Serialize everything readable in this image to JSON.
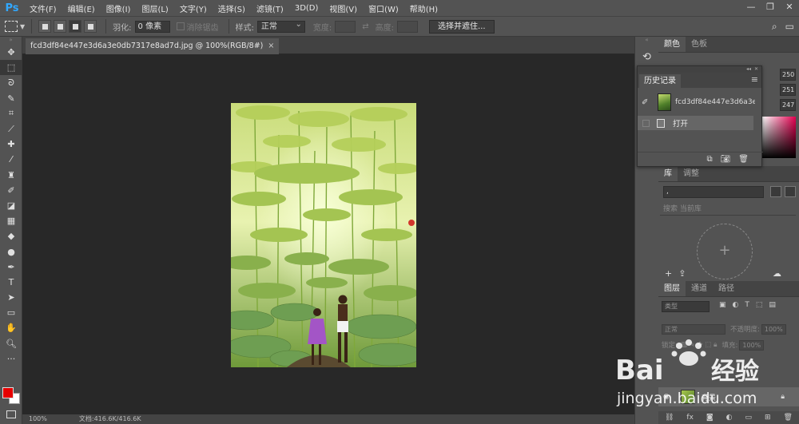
{
  "app": {
    "logo": "Ps"
  },
  "menu": [
    "文件(F)",
    "编辑(E)",
    "图像(I)",
    "图层(L)",
    "文字(Y)",
    "选择(S)",
    "滤镜(T)",
    "3D(D)",
    "视图(V)",
    "窗口(W)",
    "帮助(H)"
  ],
  "window_controls": {
    "minimize": "—",
    "restore": "❐",
    "close": "✕"
  },
  "options": {
    "feather_label": "羽化:",
    "feather_value": "0 像素",
    "antialias_label": "消除锯齿",
    "style_label": "样式:",
    "style_value": "正常",
    "width_label": "宽度:",
    "height_label": "高度:",
    "select_mask_button": "选择并遮住..."
  },
  "document": {
    "tab_title": "fcd3df84e447e3d6a3e0db7317e8ad7d.jpg @ 100%(RGB/8#)",
    "close_glyph": "×"
  },
  "status": {
    "zoom": "100%",
    "doc_info": "文档:416.6K/416.6K"
  },
  "panels": {
    "color_tabs": [
      "颜色",
      "色板"
    ],
    "color_values": [
      "250",
      "251",
      "247"
    ],
    "history": {
      "title": "历史记录",
      "snapshot_name": "fcd3df84e447e3d6a3e0...",
      "step_label": "打开"
    },
    "library_tabs": [
      "库",
      "调整"
    ],
    "library_select_value": ",",
    "library_search_placeholder": "搜索 当前库",
    "layers_tabs": [
      "图层",
      "通道",
      "路径"
    ],
    "layers_filter_label": "类型",
    "blend_mode": "正常",
    "opacity_label": "不透明度:",
    "opacity_value": "100%",
    "lock_label": "锁定:",
    "fill_label": "填充:",
    "fill_value": "100%",
    "layer_name": "背景"
  },
  "watermark": {
    "brand": "Bai",
    "brand2": "经验",
    "url": "jingyan.baidu.com"
  }
}
